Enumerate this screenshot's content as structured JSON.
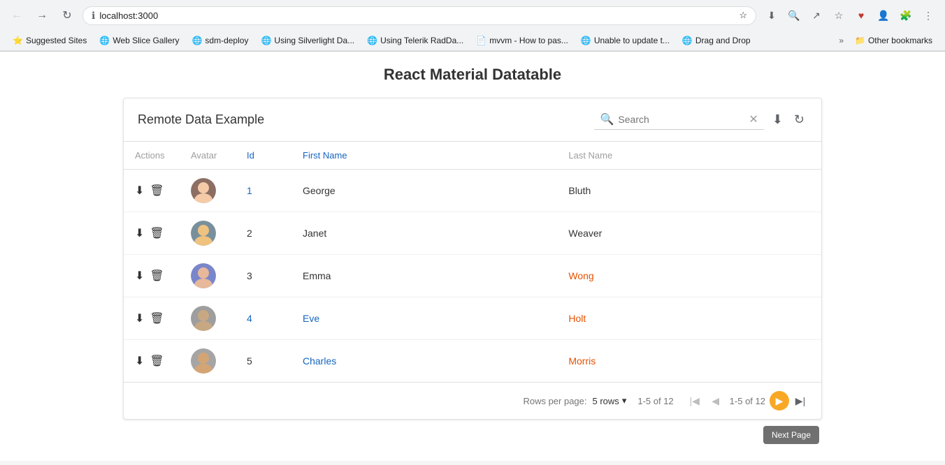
{
  "browser": {
    "url": "localhost:3000",
    "nav": {
      "back": "←",
      "forward": "→",
      "reload": "↻"
    },
    "bookmarks": [
      {
        "label": "Suggested Sites",
        "icon": "⭐"
      },
      {
        "label": "Web Slice Gallery",
        "icon": "🌐"
      },
      {
        "label": "sdm-deploy",
        "icon": "🌐"
      },
      {
        "label": "Using Silverlight Da...",
        "icon": "🌐"
      },
      {
        "label": "Using Telerik RadDa...",
        "icon": "🌐"
      },
      {
        "label": "mvvm - How to pas...",
        "icon": "📄"
      },
      {
        "label": "Unable to update t...",
        "icon": "🌐"
      },
      {
        "label": "Drag and Drop",
        "icon": "🌐"
      }
    ],
    "other_bookmarks": "Other bookmarks"
  },
  "page": {
    "title": "React Material Datatable"
  },
  "table": {
    "title": "Remote Data Example",
    "search": {
      "placeholder": "Search",
      "value": ""
    },
    "columns": [
      {
        "key": "actions",
        "label": "Actions"
      },
      {
        "key": "avatar",
        "label": "Avatar"
      },
      {
        "key": "id",
        "label": "Id"
      },
      {
        "key": "firstname",
        "label": "First Name"
      },
      {
        "key": "lastname",
        "label": "Last Name"
      }
    ],
    "rows": [
      {
        "id": "1",
        "idLinked": true,
        "firstname": "George",
        "firstnameLinked": false,
        "lastname": "Bluth",
        "lastnameLinked": false,
        "avatarColor": "#8d6e63"
      },
      {
        "id": "2",
        "idLinked": false,
        "firstname": "Janet",
        "firstnameLinked": false,
        "lastname": "Weaver",
        "lastnameLinked": false,
        "avatarColor": "#78909c"
      },
      {
        "id": "3",
        "idLinked": false,
        "firstname": "Emma",
        "firstnameLinked": false,
        "lastname": "Wong",
        "lastnameLinked": true,
        "avatarColor": "#7986cb"
      },
      {
        "id": "4",
        "idLinked": true,
        "firstname": "Eve",
        "firstnameLinked": true,
        "lastname": "Holt",
        "lastnameLinked": true,
        "avatarColor": "#9e9e9e"
      },
      {
        "id": "5",
        "idLinked": false,
        "firstname": "Charles",
        "firstnameLinked": true,
        "lastname": "Morris",
        "lastnameLinked": true,
        "avatarColor": "#a5a5a5"
      }
    ],
    "pagination": {
      "rows_per_page_label": "Rows per page:",
      "rows_per_page_value": "5 rows",
      "range_label": "1-5 of 12",
      "page_range": "1-5 of 12"
    }
  },
  "tooltip": {
    "text": "Next Page"
  }
}
